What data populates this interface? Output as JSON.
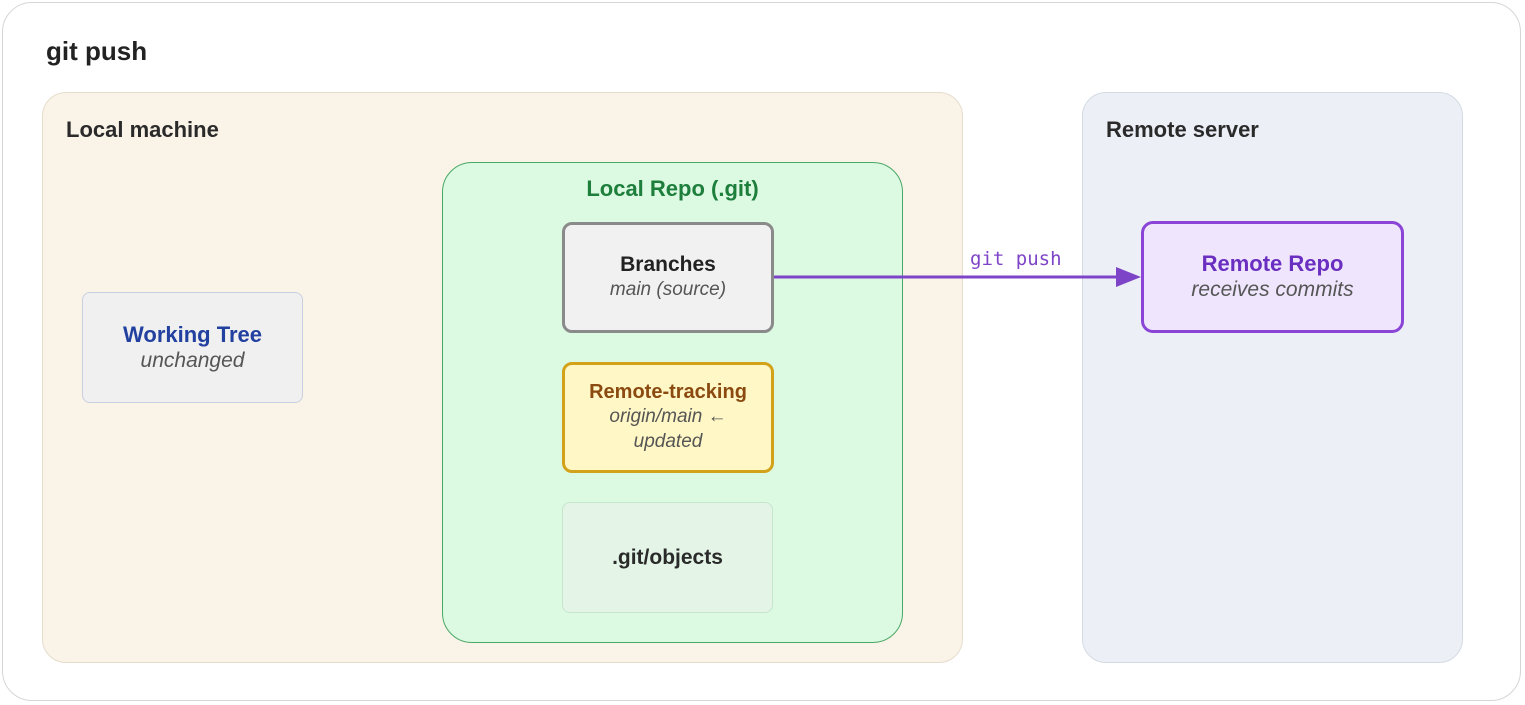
{
  "title": "git push",
  "local_machine": {
    "label": "Local machine",
    "working_tree": {
      "name": "Working Tree",
      "status": "unchanged"
    },
    "local_repo": {
      "label": "Local Repo (.git)",
      "branches": {
        "name": "Branches",
        "detail": "main (source)"
      },
      "remote_tracking": {
        "name": "Remote-tracking",
        "detail_line1": "origin/main ←",
        "detail_line2": "updated"
      },
      "objects": {
        "name": ".git/objects"
      }
    }
  },
  "remote_server": {
    "label": "Remote server",
    "remote_repo": {
      "name": "Remote Repo",
      "detail": "receives commits"
    }
  },
  "edges": [
    {
      "from": "Branches",
      "to": "Remote Repo",
      "label": "git push",
      "color": "#7e44c8"
    }
  ],
  "colors": {
    "local_machine_bg": "#faf3e8",
    "remote_server_bg": "#ecf0f6",
    "local_repo_bg": "#dcf9e2",
    "local_repo_accent": "#1e7f3c",
    "working_tree_accent": "#2140a0",
    "remote_tracking_accent": "#d3a21b",
    "remote_repo_accent": "#8a44d6"
  }
}
